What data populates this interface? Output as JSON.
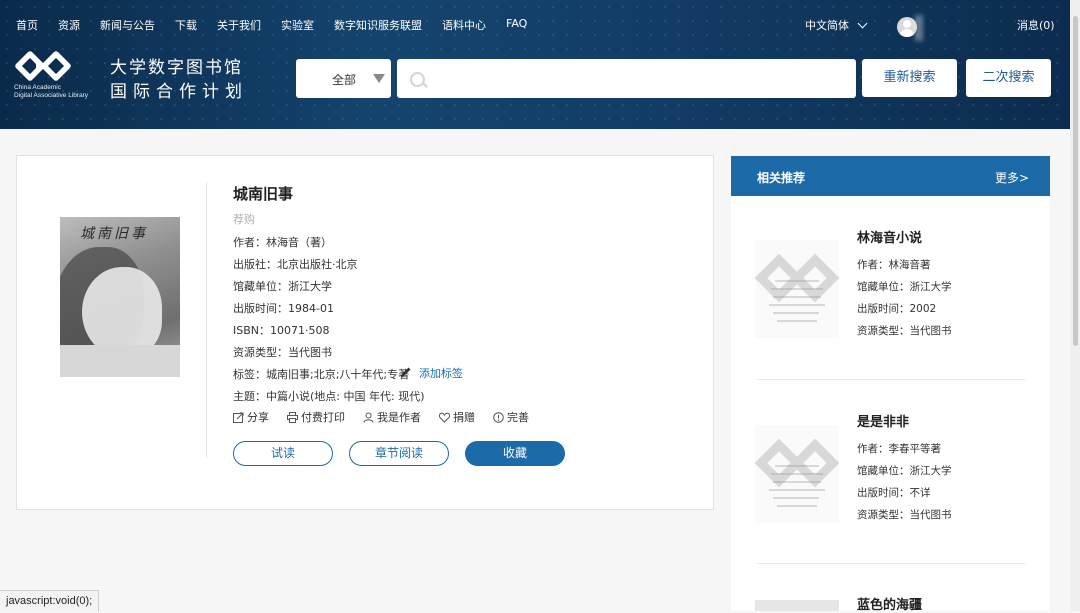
{
  "topnav": {
    "items": [
      "首页",
      "资源",
      "新闻与公告",
      "下载",
      "关于我们",
      "实验室",
      "数字知识服务联盟",
      "语料中心",
      "FAQ"
    ],
    "language": "中文简体",
    "messages": "消息(0)"
  },
  "logo": {
    "line1": "China Academic",
    "line2": "Digital Associative Library",
    "title1": "大学数字图书馆",
    "title2": "国际合作计划"
  },
  "search": {
    "category": "全部",
    "value": "",
    "placeholder": "",
    "re_search": "重新搜索",
    "second_search": "二次搜索"
  },
  "book": {
    "title": "城南旧事",
    "status": "荐购",
    "author": "作者：林海音（著）",
    "publisher": "出版社：北京出版社·北京",
    "holding": "馆藏单位：浙江大学",
    "pubdate": "出版时间：1984-01",
    "isbn": "ISBN：10071·508",
    "type": "资源类型：当代图书",
    "tags": "标签：城南旧事;北京;八十年代;专著",
    "add_tag": "添加标签",
    "subject": "主题：中篇小说(地点: 中国 年代: 现代)",
    "cover_text": "城南旧事",
    "actions": {
      "share": "分享",
      "print": "付费打印",
      "author": "我是作者",
      "donate": "捐赠",
      "improve": "完善"
    },
    "buttons": {
      "try": "试读",
      "chapter": "章节阅读",
      "favorite": "收藏"
    }
  },
  "related": {
    "header": "相关推荐",
    "more": "更多>",
    "items": [
      {
        "title": "林海音小说",
        "author": "作者：林海音著",
        "holding": "馆藏单位：浙江大学",
        "pubdate": "出版时间：2002",
        "type": "资源类型：当代图书"
      },
      {
        "title": "是是非非",
        "author": "作者：李春平等著",
        "holding": "馆藏单位：浙江大学",
        "pubdate": "出版时间：不详",
        "type": "资源类型：当代图书"
      },
      {
        "title": "蓝色的海疆"
      }
    ]
  },
  "statusbar": "javascript:void(0);",
  "colors": {
    "primary": "#1c6aa8",
    "header_bg": "#123d66",
    "link": "#1a6eb0"
  }
}
